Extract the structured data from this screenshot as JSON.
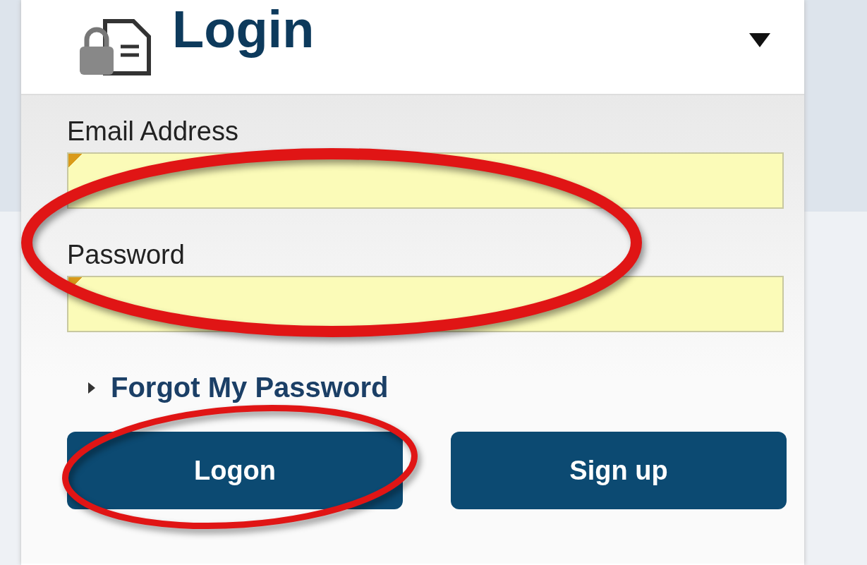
{
  "panel": {
    "title": "Login"
  },
  "fields": [
    {
      "label": "Email Address"
    },
    {
      "label": "Password"
    }
  ],
  "forgot_link": "Forgot My Password",
  "buttons": [
    "Logon",
    "Sign up"
  ]
}
